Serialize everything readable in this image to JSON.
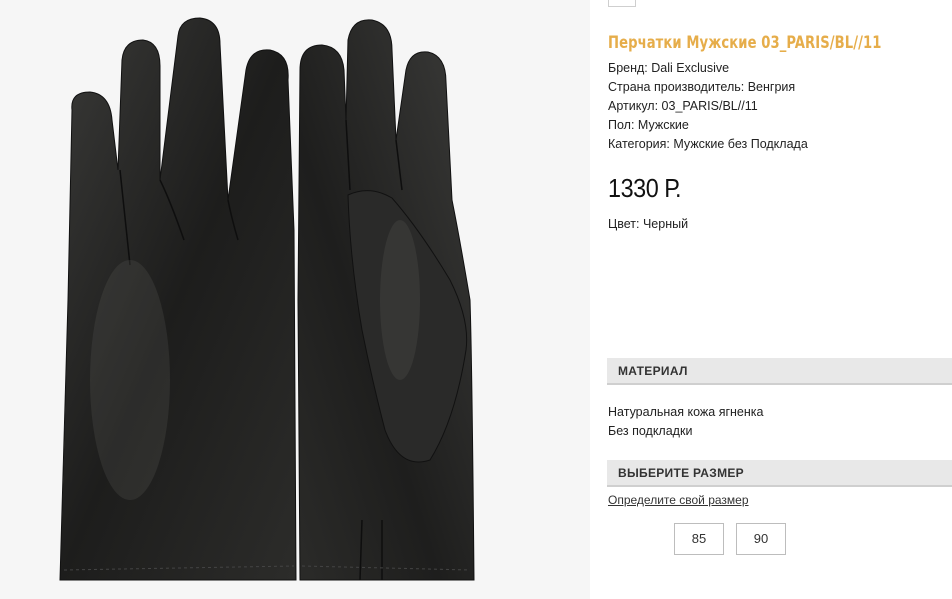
{
  "product": {
    "title": "Перчатки Мужские 03_PARIS/BL//11",
    "specs": [
      {
        "label": "Бренд: Dali Exclusive"
      },
      {
        "label": "Страна производитель: Венгрия"
      },
      {
        "label": "Артикул: 03_PARIS/BL//11"
      },
      {
        "label": "Пол: Мужские"
      },
      {
        "label": "Категория: Мужские без Подклада"
      }
    ],
    "price": "1330 Р.",
    "color": "Цвет: Черный"
  },
  "material": {
    "header": "МАТЕРИАЛ",
    "lines": [
      "Натуральная кожа ягненка",
      "Без подкладки"
    ]
  },
  "size": {
    "header": "ВЫБЕРИТЕ РАЗМЕР",
    "guide_link": "Определите свой размер",
    "options": [
      "85",
      "90"
    ]
  },
  "colors": {
    "accent": "#e6ad4a",
    "header_bg": "#e8e8e8"
  }
}
